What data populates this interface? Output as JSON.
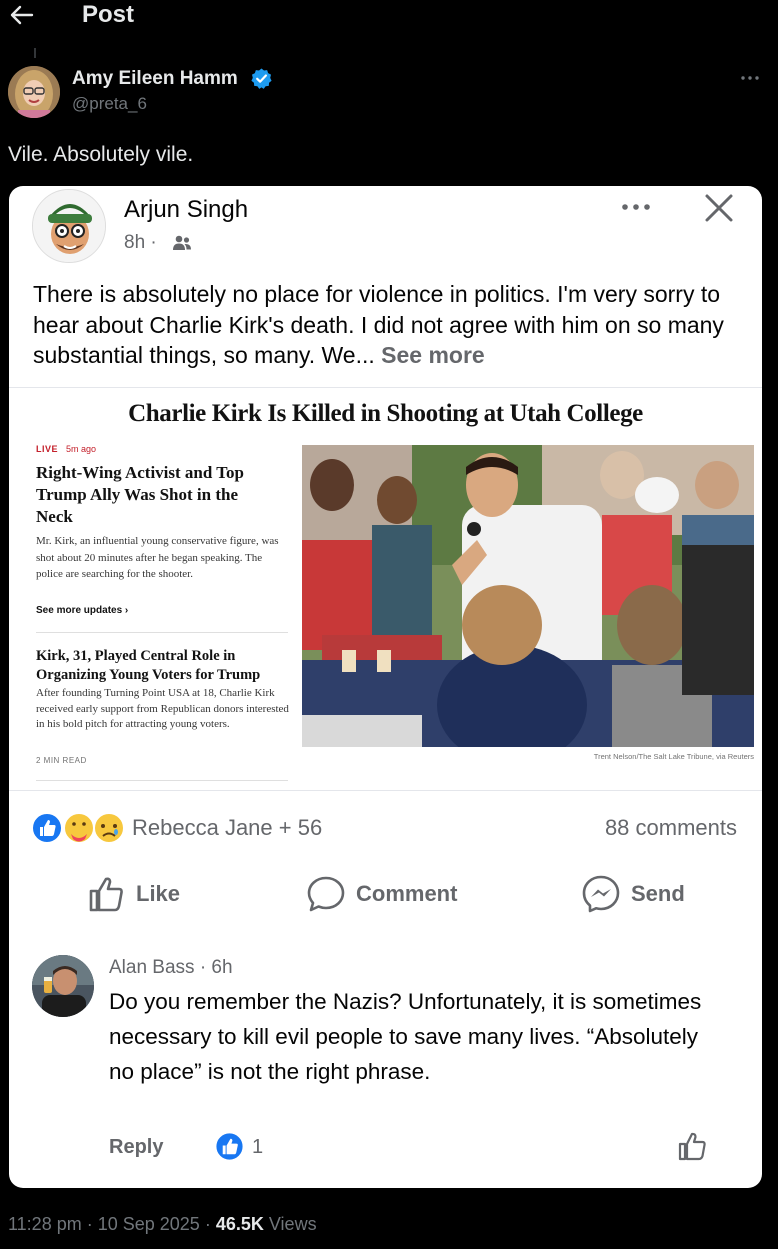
{
  "topbar": {
    "title": "Post"
  },
  "author": {
    "name": "Amy Eileen Hamm",
    "handle": "@preta_6"
  },
  "tweet": {
    "text": "Vile. Absolutely vile.",
    "time": "11:28 pm",
    "date": "10 Sep 2025",
    "views_count": "46.5K",
    "views_label": "Views"
  },
  "fb_post": {
    "author_name": "Arjun Singh",
    "time": "8h ·",
    "text": "There is absolutely no place for violence in politics. I'm very sorry to hear about Charlie Kirk's death. I did not agree with him on so many substantial things, so many. We...",
    "see_more": "See more",
    "article": {
      "headline": "Charlie Kirk Is Killed in Shooting at Utah College",
      "live_label": "LIVE",
      "live_time": "5m ago",
      "story1_title": "Right-Wing Activist and Top Trump Ally Was Shot in the Neck",
      "story1_summary": "Mr. Kirk, an influential young conservative figure, was shot about 20 minutes after he began speaking. The police are searching for the shooter.",
      "see_updates": "See more updates ›",
      "story2_title": "Kirk, 31, Played Central Role in Organizing Young Voters for Trump",
      "story2_summary": "After founding Turning Point USA at 18, Charlie Kirk received early support from Republican donors interested in his bold pitch for attracting young voters.",
      "read_time": "2 MIN READ",
      "photo_credit": "Trent Nelson/The Salt Lake Tribune, via Reuters"
    },
    "reactions_text": "Rebecca Jane + 56",
    "comments_count": "88 comments",
    "actions": {
      "like": "Like",
      "comment": "Comment",
      "send": "Send"
    },
    "comment": {
      "author": "Alan Bass · 6h",
      "text": "Do you remember the Nazis? Unfortunately, it is sometimes necessary to kill evil people to save many lives. “Absolutely no place” is not the right phrase.",
      "reply_label": "Reply",
      "like_count": "1"
    }
  },
  "colors": {
    "x_background": "#000000",
    "x_text": "#e7e9ea",
    "x_secondary": "#71767b",
    "verified_blue": "#1d9bf0",
    "fb_secondary": "#65676b",
    "fb_like_blue": "#1877f2",
    "nyt_red": "#c4202b"
  },
  "icons": [
    "back-arrow-icon",
    "verified-badge-icon",
    "more-icon",
    "friends-icon",
    "close-icon",
    "like-icon",
    "comment-icon",
    "messenger-icon",
    "like-reaction-icon",
    "care-reaction-icon",
    "sad-reaction-icon"
  ]
}
